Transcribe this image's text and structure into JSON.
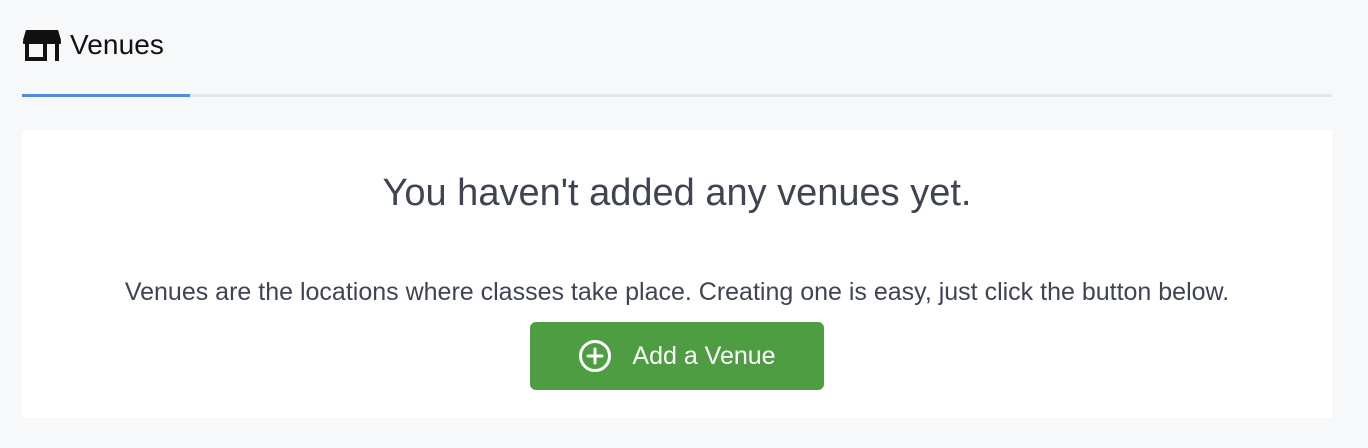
{
  "header": {
    "title": "Venues",
    "icon": "store-icon"
  },
  "tabs": {
    "active_color": "#4a8ee0"
  },
  "empty_state": {
    "heading": "You haven't added any venues yet.",
    "description": "Venues are the locations where classes take place. Creating one is easy, just click the button below.",
    "button_label": "Add a Venue",
    "button_icon": "plus-circle-icon",
    "button_color": "#4e9d43"
  }
}
